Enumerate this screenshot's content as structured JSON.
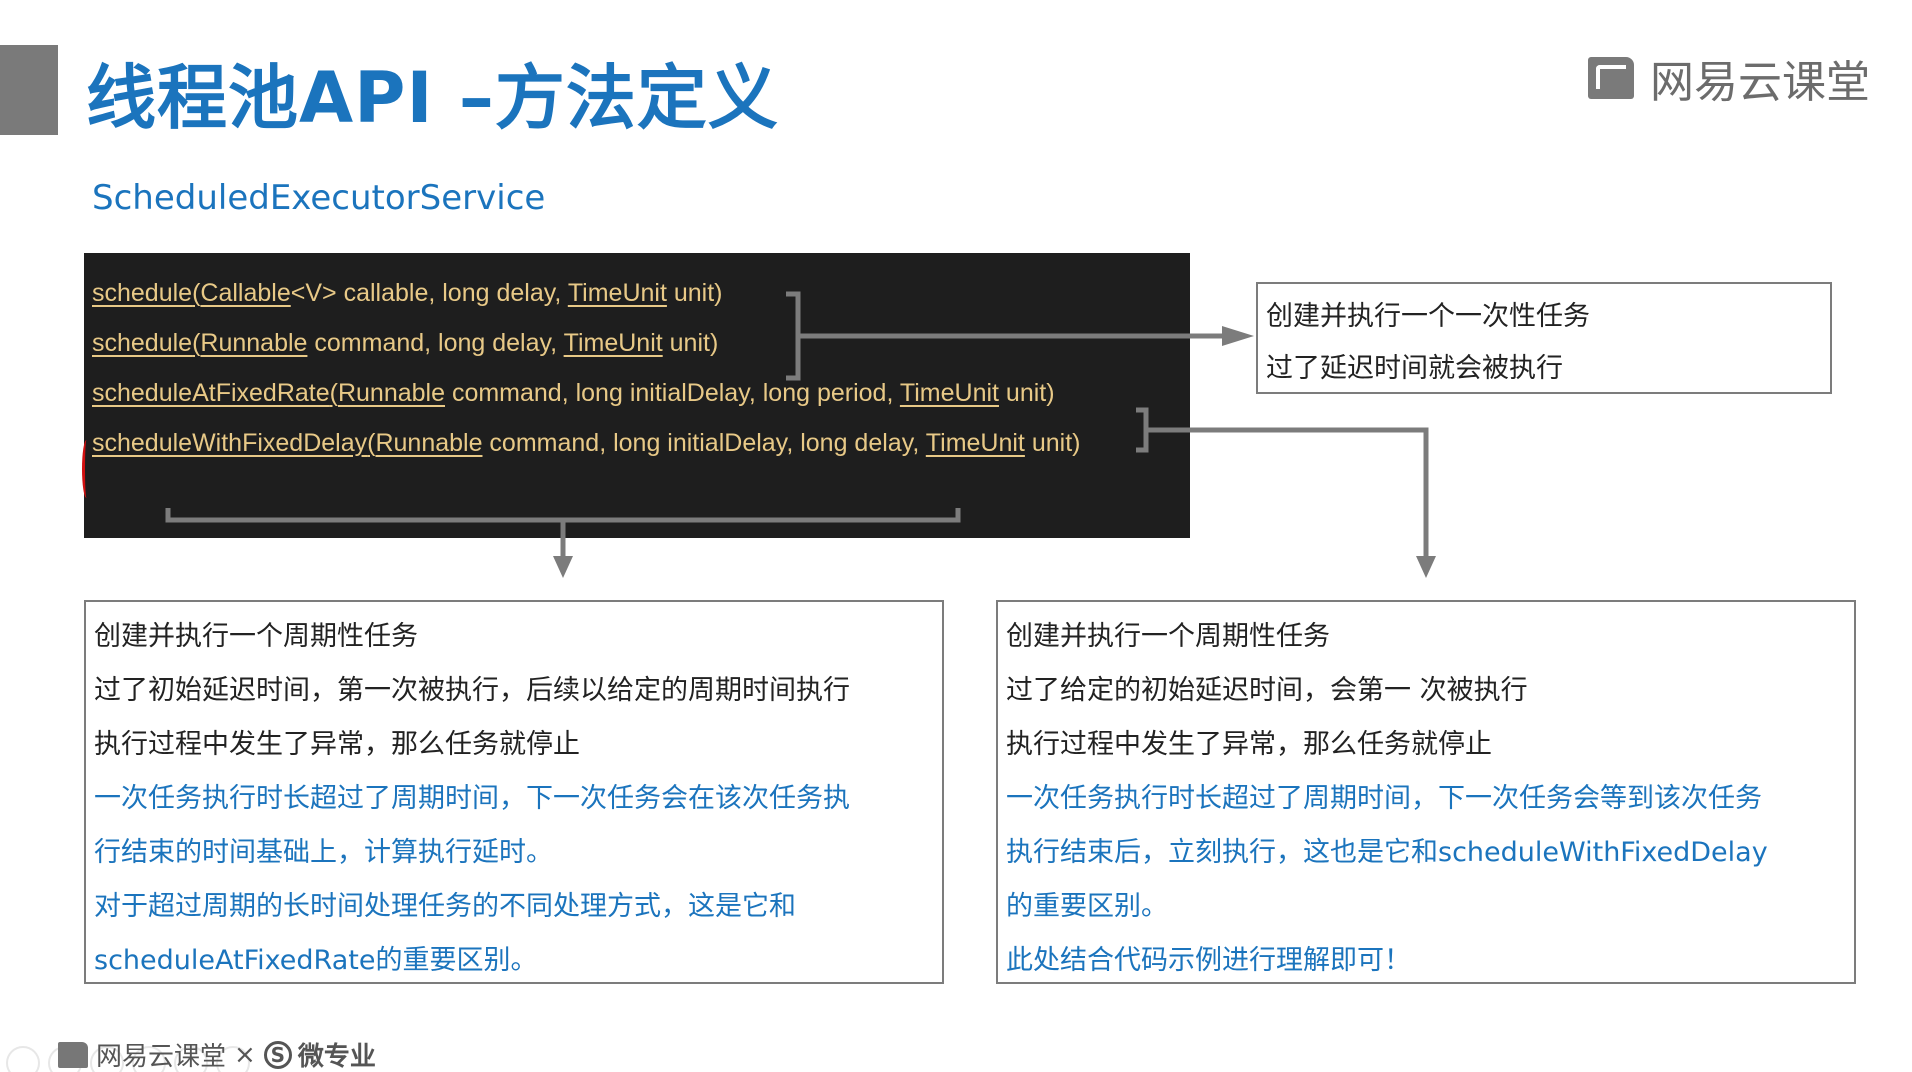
{
  "title": "线程池API –方法定义",
  "brand": "网易云课堂",
  "subtitle": "ScheduledExecutorService",
  "code_lines": [
    {
      "name": "schedule",
      "params_open": "(",
      "type1": "Callable",
      "rest1": "<V> callable, long delay, ",
      "unit_type": "TimeUnit",
      "tail": " unit)"
    },
    {
      "name": "schedule",
      "params_open": "(",
      "type1": "Runnable",
      "rest1": " command, long delay, ",
      "unit_type": "TimeUnit",
      "tail": " unit)"
    },
    {
      "name": "scheduleAtFixedRate",
      "params_open": "(",
      "type1": "Runnable",
      "rest1": " command, long initialDelay, long period, ",
      "unit_type": "TimeUnit",
      "tail": " unit)"
    },
    {
      "name": "scheduleWithFixedDelay",
      "params_open": "(",
      "type1": "Runnable",
      "rest1": " command, long initialDelay, long delay, ",
      "unit_type": "TimeUnit",
      "tail": " unit)"
    }
  ],
  "box_once": {
    "lines": [
      "创建并执行一个一次性任务",
      "过了延迟时间就会被执行"
    ]
  },
  "box_fixed_rate": {
    "lines": [
      {
        "text": "创建并执行一个周期性任务",
        "blue": false
      },
      {
        "text": "过了初始延迟时间，第一次被执行，后续以给定的周期时间执行",
        "blue": false
      },
      {
        "text": "执行过程中发生了异常，那么任务就停止",
        "blue": false
      },
      {
        "text": "一次任务执行时长超过了周期时间，下一次任务会在该次任务执",
        "blue": true
      },
      {
        "text": "行结束的时间基础上，计算执行延时。",
        "blue": true
      },
      {
        "text": "对于超过周期的长时间处理任务的不同处理方式，这是它和",
        "blue": true
      },
      {
        "text": "scheduleAtFixedRate的重要区别。",
        "blue": true
      }
    ]
  },
  "box_fixed_delay": {
    "lines": [
      {
        "text": "创建并执行一个周期性任务",
        "blue": false
      },
      {
        "text": "过了给定的初始延迟时间，会第一 次被执行",
        "blue": false
      },
      {
        "text": "执行过程中发生了异常，那么任务就停止",
        "blue": false
      },
      {
        "text": "一次任务执行时长超过了周期时间，下一次任务会等到该次任务",
        "blue": true
      },
      {
        "text": "执行结束后，立刻执行，这也是它和scheduleWithFixedDelay",
        "blue": true
      },
      {
        "text": "的重要区别。",
        "blue": true
      },
      {
        "text": "此处结合代码示例进行理解即可！",
        "blue": true
      }
    ]
  },
  "footer": {
    "brand": "网易云课堂",
    "separator": "×",
    "s_letter": "S",
    "partner": "微专业"
  },
  "colors": {
    "accent_blue": "#1b74bd",
    "code_bg": "#1e1e1e",
    "code_text": "#e8c987",
    "connector": "#7c7c7c",
    "title_bar": "#7a7a7a"
  }
}
